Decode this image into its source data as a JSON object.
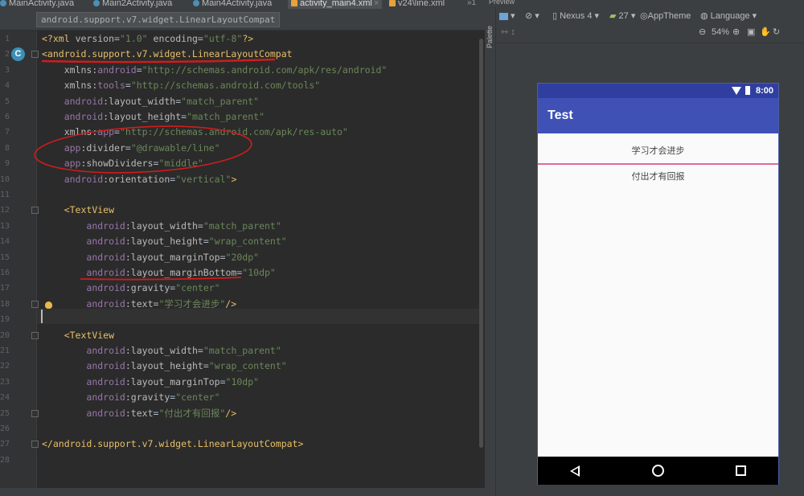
{
  "tabs": [
    {
      "label": "MainActivity.java",
      "active": false
    },
    {
      "label": "Main2Activity.java",
      "active": false
    },
    {
      "label": "Main4Activity.java",
      "active": false
    },
    {
      "label": "activity_main4.xml",
      "active": true
    },
    {
      "label": "v24\\line.xml",
      "active": false
    }
  ],
  "tab_overflow": "»1",
  "breadcrumb": "android.support.v7.widget.LinearLayoutCompat",
  "editor": {
    "line_numbers": [
      "1",
      "2",
      "3",
      "4",
      "5",
      "6",
      "7",
      "8",
      "9",
      "10",
      "11",
      "12",
      "13",
      "14",
      "15",
      "16",
      "17",
      "18",
      "19",
      "20",
      "21",
      "22",
      "23",
      "24",
      "25",
      "26",
      "27",
      "28"
    ],
    "lines": [
      "<?xml version=\"1.0\" encoding=\"utf-8\"?>",
      "<android.support.v7.widget.LinearLayoutCompat",
      "    xmlns:android=\"http://schemas.android.com/apk/res/android\"",
      "    xmlns:tools=\"http://schemas.android.com/tools\"",
      "    android:layout_width=\"match_parent\"",
      "    android:layout_height=\"match_parent\"",
      "    xmlns:app=\"http://schemas.android.com/apk/res-auto\"",
      "    app:divider=\"@drawable/line\"",
      "    app:showDividers=\"middle\"",
      "    android:orientation=\"vertical\">",
      "",
      "    <TextView",
      "        android:layout_width=\"match_parent\"",
      "        android:layout_height=\"wrap_content\"",
      "        android:layout_marginTop=\"20dp\"",
      "        android:layout_marginBottom=\"10dp\"",
      "        android:gravity=\"center\"",
      "        android:text=\"学习才会进步\"/>",
      "",
      "    <TextView",
      "        android:layout_width=\"match_parent\"",
      "        android:layout_height=\"wrap_content\"",
      "        android:layout_marginTop=\"10dp\"",
      "        android:gravity=\"center\"",
      "        android:text=\"付出才有回报\"/>",
      "",
      "</android.support.v7.widget.LinearLayoutCompat>",
      ""
    ]
  },
  "preview": {
    "title": "Preview",
    "palette_label": "Palette",
    "toolbar": {
      "device": "Nexus 4",
      "api": "27",
      "theme": "AppTheme",
      "language": "Language",
      "zoom": "54%"
    },
    "phone": {
      "status_time": "8:00",
      "app_title": "Test",
      "text1": "学习才会进步",
      "text2": "付出才有回报"
    }
  },
  "colors": {
    "accent": "#3f51b5",
    "status_bar": "#303f9f",
    "divider": "#e06aa0",
    "annotation": "#d01c1c"
  }
}
